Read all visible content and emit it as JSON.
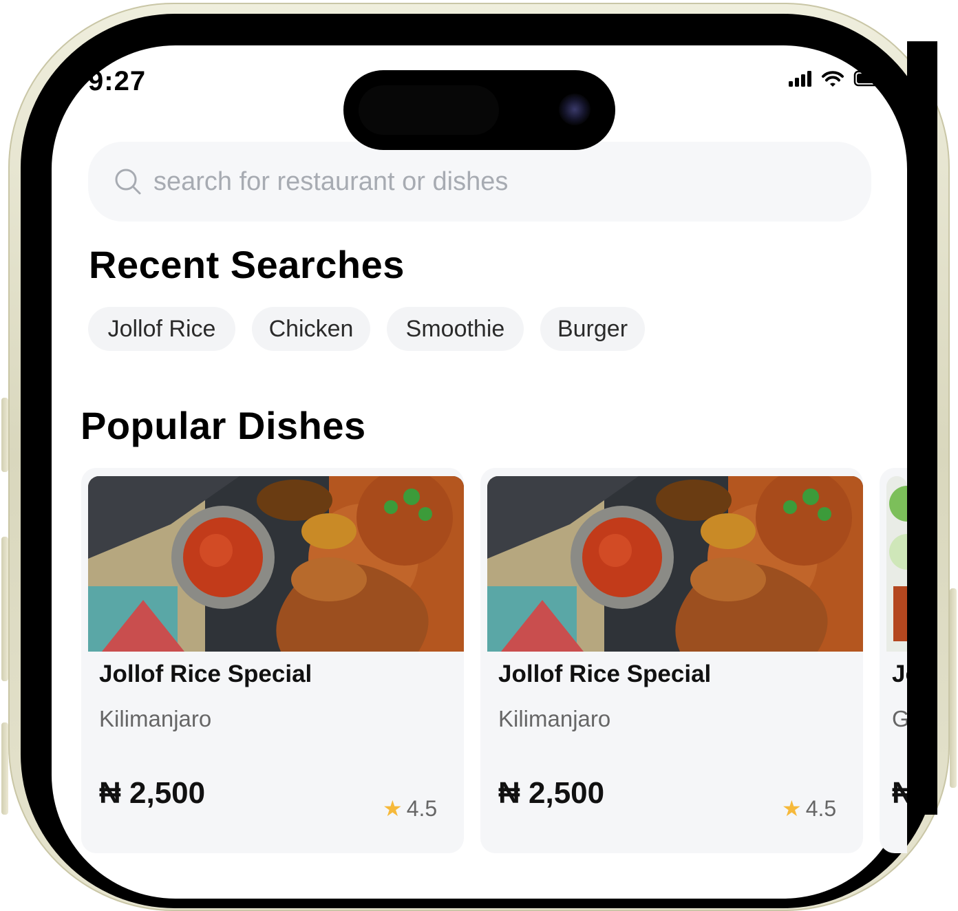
{
  "status_bar": {
    "time": "9:27"
  },
  "search": {
    "placeholder": "search for restaurant or dishes"
  },
  "recent": {
    "title": "Recent Searches",
    "chips": [
      "Jollof Rice",
      "Chicken",
      "Smoothie",
      "Burger"
    ]
  },
  "popular": {
    "title": "Popular Dishes",
    "cards": [
      {
        "name": "Jollof Rice Special",
        "restaurant": "Kilimanjaro",
        "price": "₦ 2,500",
        "rating": "4.5"
      },
      {
        "name": "Jollof Rice Special",
        "restaurant": "Kilimanjaro",
        "price": "₦ 2,500",
        "rating": "4.5"
      },
      {
        "name": "Jo",
        "restaurant": "G",
        "price": "₦",
        "rating": ""
      }
    ]
  },
  "colors": {
    "accent_star": "#f6b93b",
    "chip_bg": "#f3f4f6",
    "card_bg": "#f5f6f8",
    "placeholder": "#a7abb2"
  }
}
